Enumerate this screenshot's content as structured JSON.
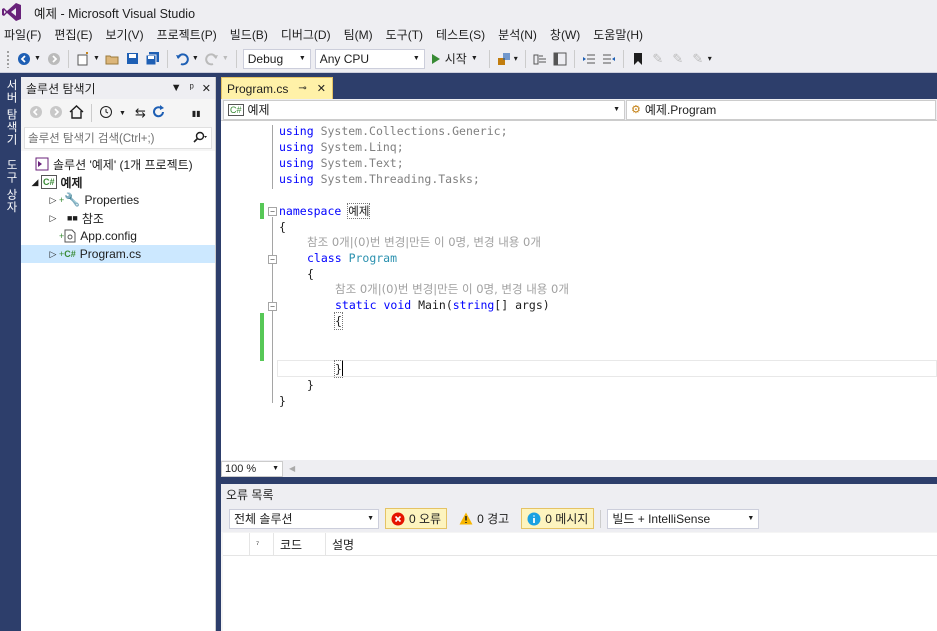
{
  "window": {
    "title": "예제 - Microsoft Visual Studio"
  },
  "menu": [
    "파일(F)",
    "편집(E)",
    "보기(V)",
    "프로젝트(P)",
    "빌드(B)",
    "디버그(D)",
    "팀(M)",
    "도구(T)",
    "테스트(S)",
    "분석(N)",
    "창(W)",
    "도움말(H)"
  ],
  "toolbar": {
    "config": "Debug",
    "platform": "Any CPU",
    "start_label": "시작"
  },
  "side_tabs": {
    "server_explorer": "서버 탐색기",
    "toolbox": "도구 상자"
  },
  "solution_explorer": {
    "title": "솔루션 탐색기",
    "search_placeholder": "솔루션 탐색기 검색(Ctrl+;)",
    "solution": "솔루션 '예제' (1개 프로젝트)",
    "project": "예제",
    "items": [
      "Properties",
      "참조",
      "App.config",
      "Program.cs"
    ]
  },
  "editor": {
    "tab": "Program.cs",
    "nav_left": "예제",
    "nav_right": "예제.Program",
    "zoom": "100 %",
    "codelens_class": "참조 0개|(0)번 변경|만든 이 0명, 변경 내용 0개",
    "codelens_method": "참조 0개|(0)번 변경|만든 이 0명, 변경 내용 0개",
    "usings": [
      "System.Collections.Generic;",
      "System.Linq;",
      "System.Text;",
      "System.Threading.Tasks;"
    ],
    "kw_using": "using",
    "kw_namespace": "namespace",
    "namespace_name": "예제",
    "kw_class": "class",
    "class_name": "Program",
    "kw_static": "static",
    "kw_void": "void",
    "method_name": "Main(",
    "kw_string": "string",
    "method_args": "[] args)",
    "brace_open": "{",
    "brace_close": "}"
  },
  "error_list": {
    "title": "오류 목록",
    "scope": "전체 솔루션",
    "errors": "0 오류",
    "warnings": "0 경고",
    "messages": "0 메시지",
    "source": "빌드 + IntelliSense",
    "col_code": "코드",
    "col_desc": "설명"
  }
}
